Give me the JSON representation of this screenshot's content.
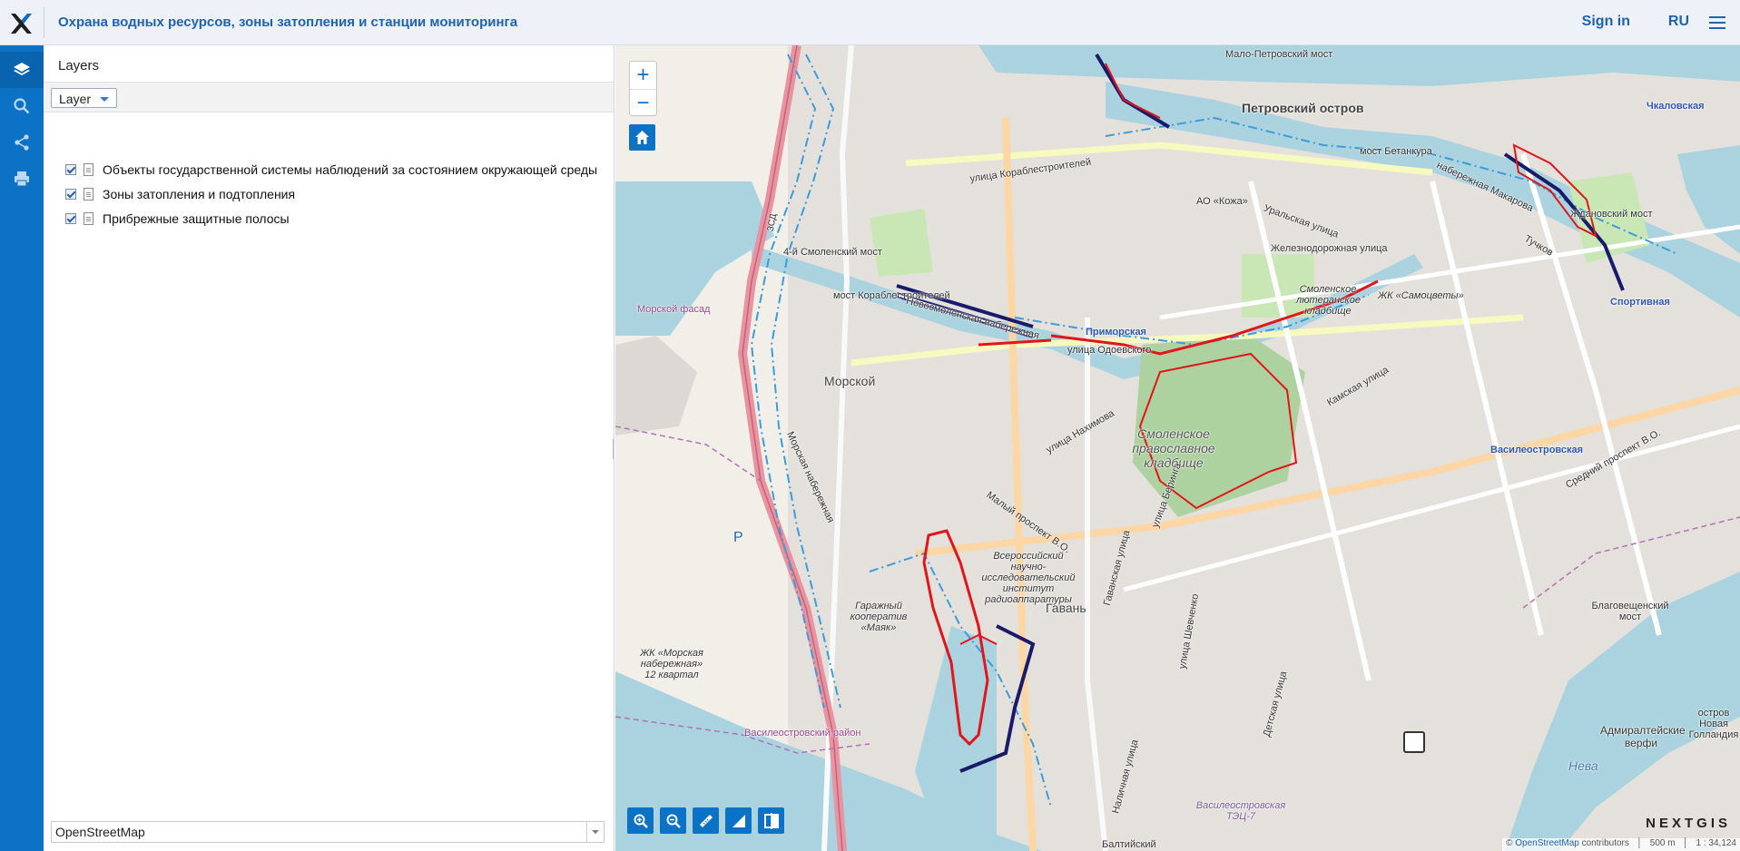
{
  "header": {
    "title": "Охрана водных ресурсов, зоны затопления и станции мониторинга",
    "signin": "Sign in",
    "lang": "RU"
  },
  "panel": {
    "title": "Layers",
    "layer_button": "Layer",
    "layers": [
      {
        "label": "Объекты государственной системы наблюдений за состоянием окружающей среды",
        "checked": true
      },
      {
        "label": "Зоны затопления и подтопления",
        "checked": true
      },
      {
        "label": "Прибрежные защитные полосы",
        "checked": true
      }
    ],
    "basemap": "OpenStreetMap"
  },
  "map": {
    "labels": {
      "malo_petrovsky": "Мало-Петровский мост",
      "petrovsky": "Петровский остров",
      "chkalovskaya": "Чкаловская",
      "sportivnaya": "Спортивная",
      "zhdanovsky": "Ждановский мост",
      "betankura": "мост Бетанкура",
      "smolensky4": "4-й Смоленский мост",
      "korablestroiteley": "мост Кораблестроителей",
      "morskoy_fasad": "Морской фасад",
      "morskoy": "Морской",
      "primorskaya": "Приморская",
      "smolenskoe_lut": "Смоленское лютеранское кладбище",
      "smolenskoe_prav": "Смоленское православное кладбище",
      "samotsvety": "ЖК «Самоцветы»",
      "ao_kozha": "АО «Кожа»",
      "vasileostrovskaya": "Василеостровская",
      "gavan": "Гавань",
      "garazh": "Гаражный кооператив «Маяк»",
      "institut": "Всероссийский научно-исследовательский институт радиоаппаратуры",
      "blagoveshchensky": "Благовещенский мост",
      "admiralteyskie": "Адмиралтейские верфи",
      "novaya_gollandiya": "остров Новая Голландия",
      "neva": "Нева",
      "zhk_morskaya": "ЖК «Морская набережная» 12 квартал",
      "vo_rayon": "Василеостровский район",
      "tets7": "Василеостровская ТЭЦ-7",
      "baltiysky": "Балтийский",
      "parking": "P",
      "zsd": "ЗСД",
      "ural": "Уральская улица",
      "zheleznovodskaya": "Железнодорожная улица",
      "korablestr_ul": "улица Кораблестроителей",
      "novosmolenskaya": "Новосмоленская набережная",
      "malyy_pr": "Малый проспект В.О.",
      "morskaya_nab": "Морская набережная",
      "nakhimova": "улица Нахимова",
      "beringa": "улица Беринга",
      "shevchenko": "улица Шевченко",
      "odoevskogo": "улица Одоевского",
      "nalichnaya": "Наличная улица",
      "kamskaya": "Камская улица",
      "naberezhnaya_makarova": "набережная Макарова",
      "tuchkov": "Тучков",
      "sredniy": "Средний проспект В.О.",
      "detskaya": "Детская улица",
      "gavanskaya": "Гаванская улица"
    },
    "attribution_prefix": "©",
    "attribution_link": "OpenStreetMap",
    "attribution_suffix": "contributors",
    "scale": "500 m",
    "scale_ratio": "1 : 34,124",
    "brand": "NEXTGIS",
    "colors": {
      "water": "#aad3df",
      "land": "#f2efe9",
      "urban": "#e0dfdf",
      "green": "#c8e7b4",
      "flood": "#e3151a",
      "zone": "#1a1a6b",
      "buffer": "#3b9bdc"
    }
  }
}
